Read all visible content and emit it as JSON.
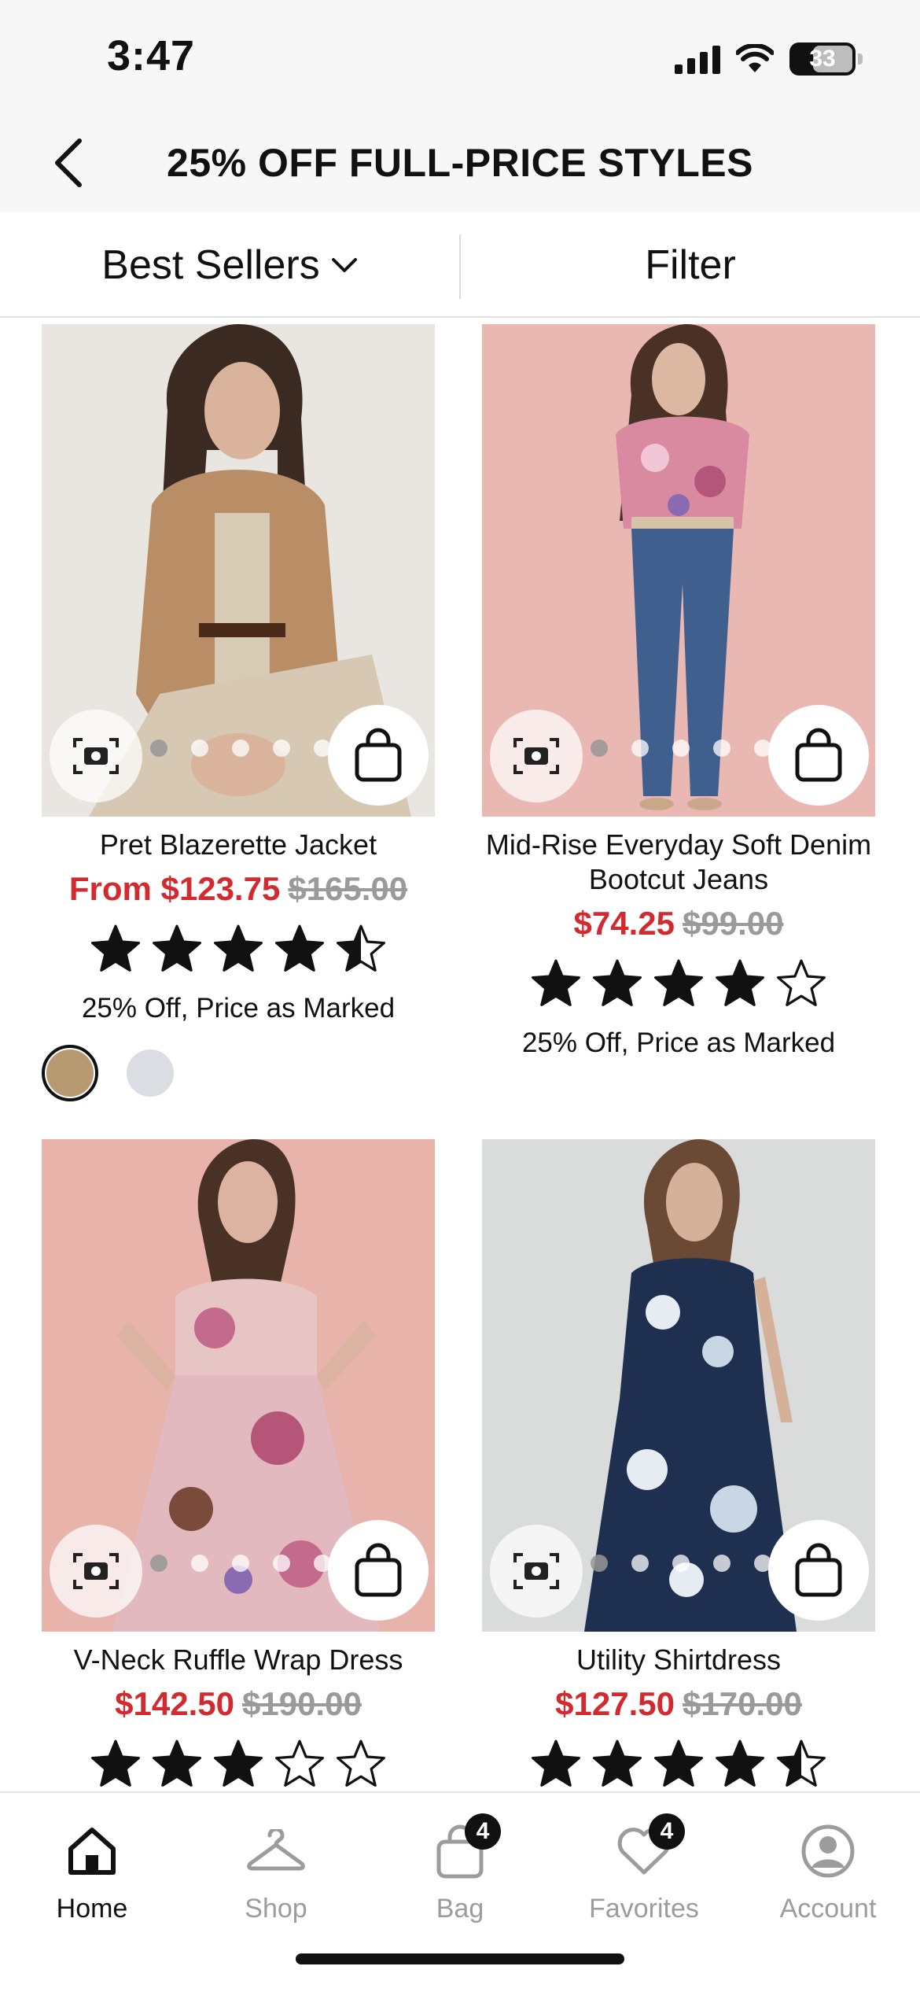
{
  "status_bar": {
    "time": "3:47",
    "battery": "33"
  },
  "header": {
    "title": "25% OFF FULL-PRICE STYLES"
  },
  "toolbar": {
    "sort_label": "Best Sellers",
    "filter_label": "Filter"
  },
  "products": [
    {
      "name": "Pret Blazerette Jacket",
      "price_sale": "From $123.75",
      "price_original": "$165.00",
      "rating": 4.5,
      "promo": "25% Off, Price as Marked",
      "image_bg": "#e9e6e1",
      "swatches": [
        {
          "color": "#b89a72",
          "selected": true
        },
        {
          "color": "#dcdde3",
          "selected": false
        }
      ]
    },
    {
      "name": "Mid-Rise Everyday Soft Denim  Bootcut Jeans",
      "price_sale": "$74.25",
      "price_original": "$99.00",
      "rating": 4,
      "promo": "25% Off, Price as Marked",
      "image_bg": "#e9b8b2"
    },
    {
      "name": "V-Neck Ruffle Wrap Dress",
      "price_sale": "$142.50",
      "price_original": "$190.00",
      "rating": 3,
      "image_bg": "#e7b3ab"
    },
    {
      "name": "Utility Shirtdress",
      "price_sale": "$127.50",
      "price_original": "$170.00",
      "rating": 4.5,
      "image_bg": "#d9dcda"
    }
  ],
  "tabbar": {
    "items": [
      {
        "label": "Home",
        "icon": "home-icon",
        "active": true
      },
      {
        "label": "Shop",
        "icon": "hanger-icon",
        "active": false
      },
      {
        "label": "Bag",
        "icon": "bag-icon",
        "active": false,
        "badge": "4"
      },
      {
        "label": "Favorites",
        "icon": "heart-icon",
        "active": false,
        "badge": "4"
      },
      {
        "label": "Account",
        "icon": "account-icon",
        "active": false
      }
    ]
  },
  "colors": {
    "sale_red": "#d32a2f",
    "strike_gray": "#9a9a9a",
    "text": "#111111"
  }
}
